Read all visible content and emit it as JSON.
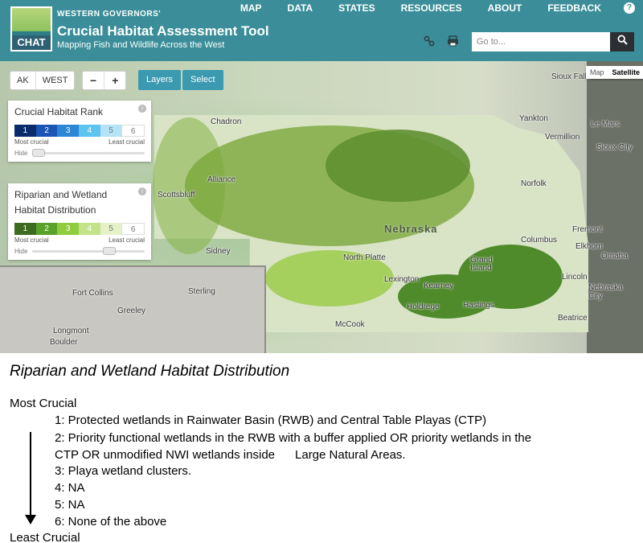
{
  "header": {
    "logo_text": "CHAT",
    "org": "WESTERN GOVERNORS'",
    "title": "Crucial Habitat Assessment Tool",
    "subtitle": "Mapping Fish and Wildlife Across the West",
    "nav": [
      "MAP",
      "DATA",
      "STATES",
      "RESOURCES",
      "ABOUT",
      "FEEDBACK"
    ],
    "help_label": "?",
    "search_placeholder": "Go to..."
  },
  "map_controls": {
    "region_buttons": [
      "AK",
      "WEST"
    ],
    "zoom_out": "−",
    "zoom_in": "+",
    "layers_label": "Layers",
    "select_label": "Select",
    "map_type": [
      "Map",
      "Satellite"
    ]
  },
  "legend_rank": {
    "title": "Crucial Habitat Rank",
    "levels": [
      "1",
      "2",
      "3",
      "4",
      "5",
      "6"
    ],
    "colors": [
      "#0a2a6b",
      "#1a55b5",
      "#2e86d6",
      "#5cc4ee",
      "#b4e3f7",
      "#ffffff"
    ],
    "most_label": "Most crucial",
    "least_label": "Least crucial",
    "hide_label": "Hide"
  },
  "legend_riparian": {
    "title": "Riparian and Wetland Habitat Distribution",
    "levels": [
      "1",
      "2",
      "3",
      "4",
      "5",
      "6"
    ],
    "colors": [
      "#3d6b1f",
      "#5aa32a",
      "#8fcd3e",
      "#c3e38a",
      "#e5f2c8",
      "#ffffff"
    ],
    "most_label": "Most crucial",
    "least_label": "Least crucial",
    "hide_label": "Hide"
  },
  "map_labels": {
    "state": "Nebraska",
    "places": [
      "Sioux Falls",
      "Chadron",
      "Yankton",
      "Le Mars",
      "Vermillion",
      "Sioux City",
      "Alliance",
      "Scottsbluff",
      "Norfolk",
      "Fremont",
      "Elkhorn",
      "Omaha",
      "Columbus",
      "North Platte",
      "Sidney",
      "Grand Island",
      "Lexington",
      "Kearney",
      "Lincoln",
      "Holdrege",
      "Hastings",
      "Nebraska City",
      "Beatrice",
      "McCook",
      "Fort Collins",
      "Sterling",
      "Greeley",
      "Longmont",
      "Boulder"
    ]
  },
  "description": {
    "title": "Riparian and Wetland Habitat Distribution",
    "most": "Most Crucial",
    "least": "Least Crucial",
    "items": [
      "1: Protected wetlands  in Rainwater Basin (RWB) and Central Table Playas (CTP)",
      "2: Priority functional wetlands  in the RWB with a buffer applied OR priority wetlands  in the",
      "CTP OR unmodified NWI wetlands inside      Large Natural Areas.",
      "3: Playa wetland clusters.",
      "4: NA",
      "5: NA",
      "6: None of the above"
    ]
  }
}
